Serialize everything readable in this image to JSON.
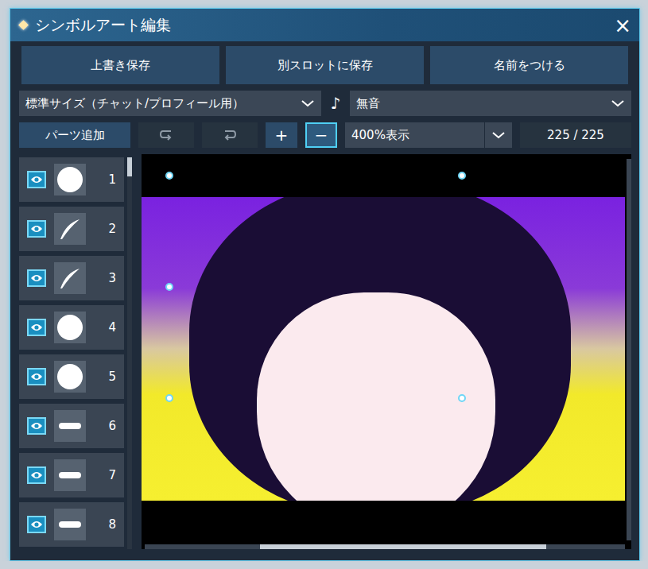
{
  "window": {
    "title": "シンボルアート編集",
    "close": "×"
  },
  "actions": [
    "上書き保存",
    "別スロットに保存",
    "名前をつける"
  ],
  "size_dropdown": {
    "value": "標準サイズ（チャット/プロフィール用）"
  },
  "sound": {
    "icon": "♪",
    "value": "無音"
  },
  "toolbar": {
    "add_part": "パーツ追加",
    "zoom_in": {
      "label": "+",
      "selected": false
    },
    "zoom_out": {
      "label": "−",
      "selected": true
    },
    "zoom": "400%表示",
    "count": "225 / 225"
  },
  "layers": [
    {
      "number": "1",
      "kind": "circle",
      "visible": true
    },
    {
      "number": "2",
      "kind": "curve",
      "visible": true
    },
    {
      "number": "3",
      "kind": "curve",
      "visible": true
    },
    {
      "number": "4",
      "kind": "circle",
      "visible": true
    },
    {
      "number": "5",
      "kind": "circle",
      "visible": true
    },
    {
      "number": "6",
      "kind": "bar",
      "visible": true
    },
    {
      "number": "7",
      "kind": "bar",
      "visible": true
    },
    {
      "number": "8",
      "kind": "bar",
      "visible": true
    }
  ]
}
